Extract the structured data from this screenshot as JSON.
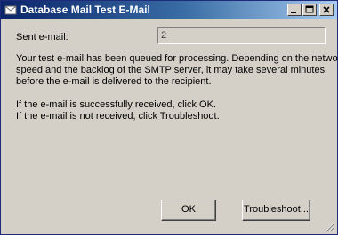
{
  "window": {
    "title": "Database Mail Test E-Mail",
    "buttons": {
      "minimize": "minimize-icon",
      "maximize": "maximize-icon",
      "close": "close-icon"
    },
    "colors": {
      "titlebar_start": "#0a246a",
      "titlebar_end": "#a6caf0",
      "face": "#d4d0c8"
    }
  },
  "form": {
    "sent_label": "Sent e-mail:",
    "sent_value": "2"
  },
  "message": {
    "line1": "Your test e-mail has been queued for processing.  Depending on the network",
    "line2": "speed and the backlog of the SMTP server, it may take several minutes",
    "line3": "before the e-mail is delivered to the recipient.",
    "line4": "If the e-mail is successfully received, click OK.",
    "line5": "If the e-mail is not received, click Troubleshoot."
  },
  "actions": {
    "ok_label": "OK",
    "troubleshoot_label": "Troubleshoot..."
  }
}
